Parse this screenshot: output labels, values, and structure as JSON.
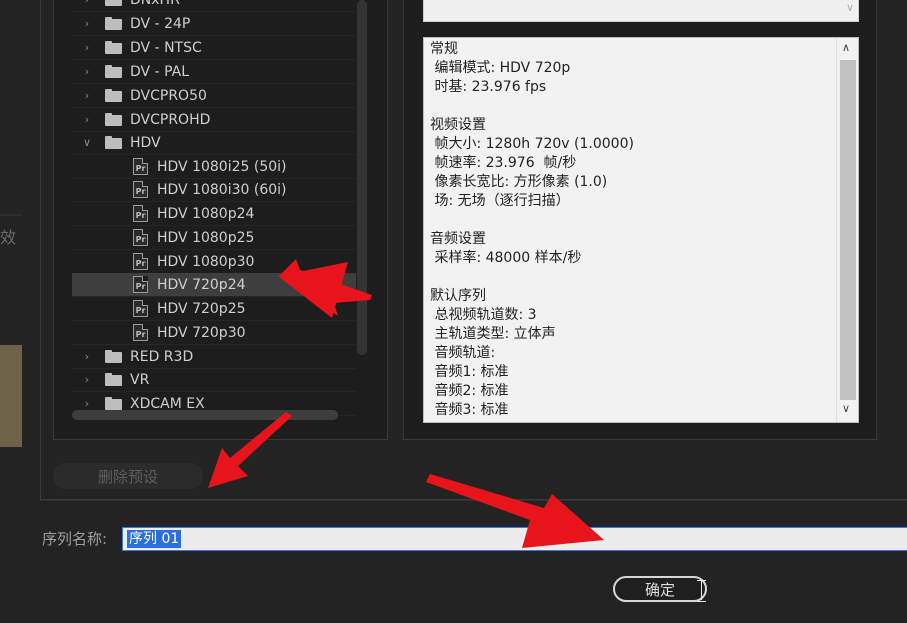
{
  "colors": {
    "annotation_arrow": "#e8141c",
    "selection_blue": "#2a6fdb",
    "tree_selected_bg": "#3e3e3e",
    "description_bg": "#f2f2f2"
  },
  "background": {
    "partial_label": "效"
  },
  "preset_tree": {
    "items": [
      {
        "kind": "folder",
        "label": "DNxHR",
        "expanded": false
      },
      {
        "kind": "folder",
        "label": "DV - 24P",
        "expanded": false
      },
      {
        "kind": "folder",
        "label": "DV - NTSC",
        "expanded": false
      },
      {
        "kind": "folder",
        "label": "DV - PAL",
        "expanded": false
      },
      {
        "kind": "folder",
        "label": "DVCPRO50",
        "expanded": false
      },
      {
        "kind": "folder",
        "label": "DVCPROHD",
        "expanded": false
      },
      {
        "kind": "folder",
        "label": "HDV",
        "expanded": true
      },
      {
        "kind": "preset",
        "label": "HDV 1080i25 (50i)",
        "icon": "Pr"
      },
      {
        "kind": "preset",
        "label": "HDV 1080i30 (60i)",
        "icon": "Pr"
      },
      {
        "kind": "preset",
        "label": "HDV 1080p24",
        "icon": "Pr"
      },
      {
        "kind": "preset",
        "label": "HDV 1080p25",
        "icon": "Pr"
      },
      {
        "kind": "preset",
        "label": "HDV 1080p30",
        "icon": "Pr"
      },
      {
        "kind": "preset",
        "label": "HDV 720p24",
        "icon": "Pr",
        "selected": true
      },
      {
        "kind": "preset",
        "label": "HDV 720p25",
        "icon": "Pr"
      },
      {
        "kind": "preset",
        "label": "HDV 720p30",
        "icon": "Pr"
      },
      {
        "kind": "folder",
        "label": "RED R3D",
        "expanded": false
      },
      {
        "kind": "folder",
        "label": "VR",
        "expanded": false
      },
      {
        "kind": "folder",
        "label": "XDCAM EX",
        "expanded": false
      }
    ]
  },
  "description": {
    "lines": [
      "常规",
      " 编辑模式: HDV 720p",
      " 时基: 23.976 fps",
      "",
      "视频设置",
      " 帧大小: 1280h 720v (1.0000)",
      " 帧速率: 23.976  帧/秒",
      " 像素长宽比: 方形像素 (1.0)",
      " 场: 无场（逐行扫描）",
      "",
      "音频设置",
      " 采样率: 48000 样本/秒",
      "",
      "默认序列",
      " 总视频轨道数: 3",
      " 主轨道类型: 立体声",
      " 音频轨道:",
      " 音频1: 标准",
      " 音频2: 标准",
      " 音频3: 标准"
    ]
  },
  "buttons": {
    "delete_preset": "删除预设",
    "ok": "确定"
  },
  "sequence": {
    "label": "序列名称:",
    "value": "序列 01"
  }
}
